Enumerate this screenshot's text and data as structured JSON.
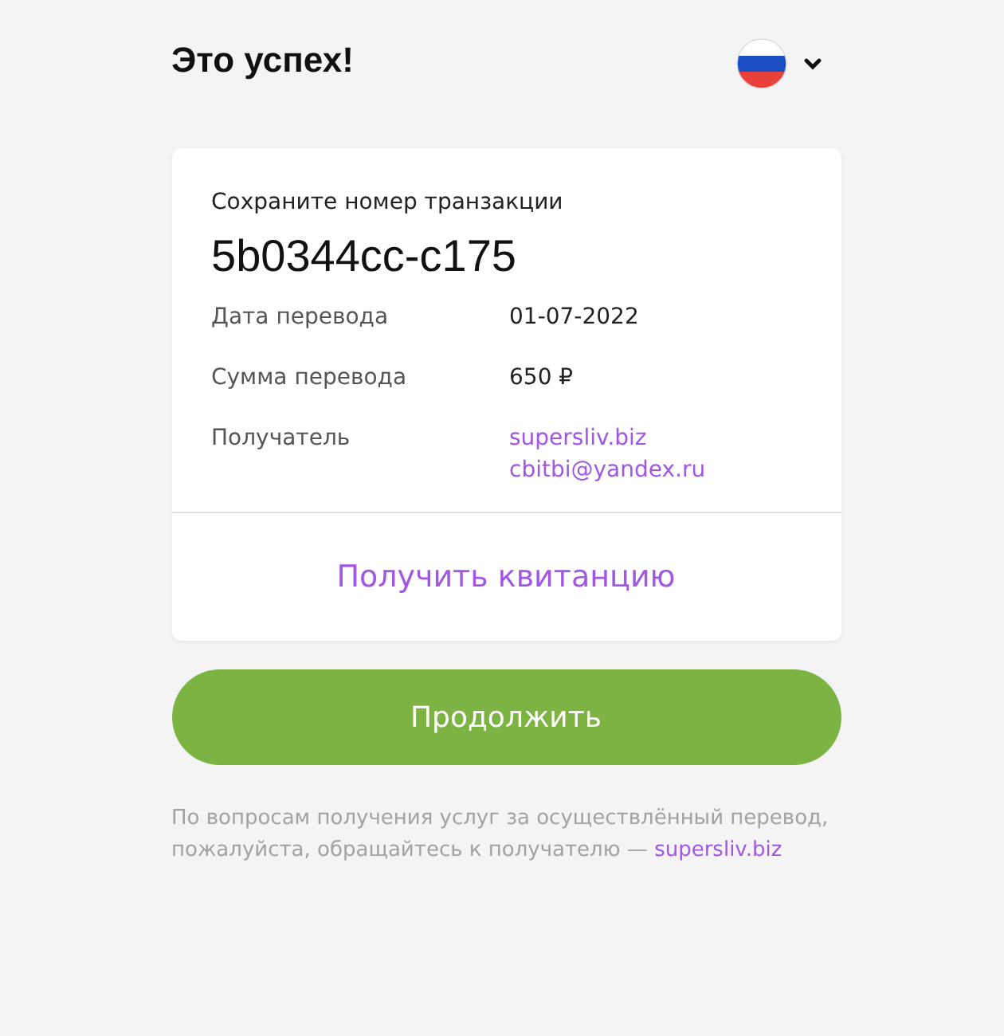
{
  "header": {
    "title": "Это успех!"
  },
  "card": {
    "caption": "Сохраните номер транзакции",
    "transaction_id": "5b0344cc-c175",
    "rows": [
      {
        "label": "Дата перевода",
        "values": [
          {
            "kind": "text",
            "text": "01-07-2022"
          }
        ]
      },
      {
        "label": "Сумма перевода",
        "values": [
          {
            "kind": "text",
            "text": "650 ₽"
          }
        ]
      },
      {
        "label": "Получатель",
        "values": [
          {
            "kind": "link",
            "text": "supersliv.biz"
          },
          {
            "kind": "link",
            "text": "cbitbi@yandex.ru"
          }
        ]
      }
    ],
    "receipt_link": "Получить квитанцию"
  },
  "continue_button": "Продолжить",
  "footer": {
    "text": "По вопросам получения услуг за осуществлённый перевод, пожалуйста, обращайтесь к получателю —",
    "link": "supersliv.biz"
  }
}
